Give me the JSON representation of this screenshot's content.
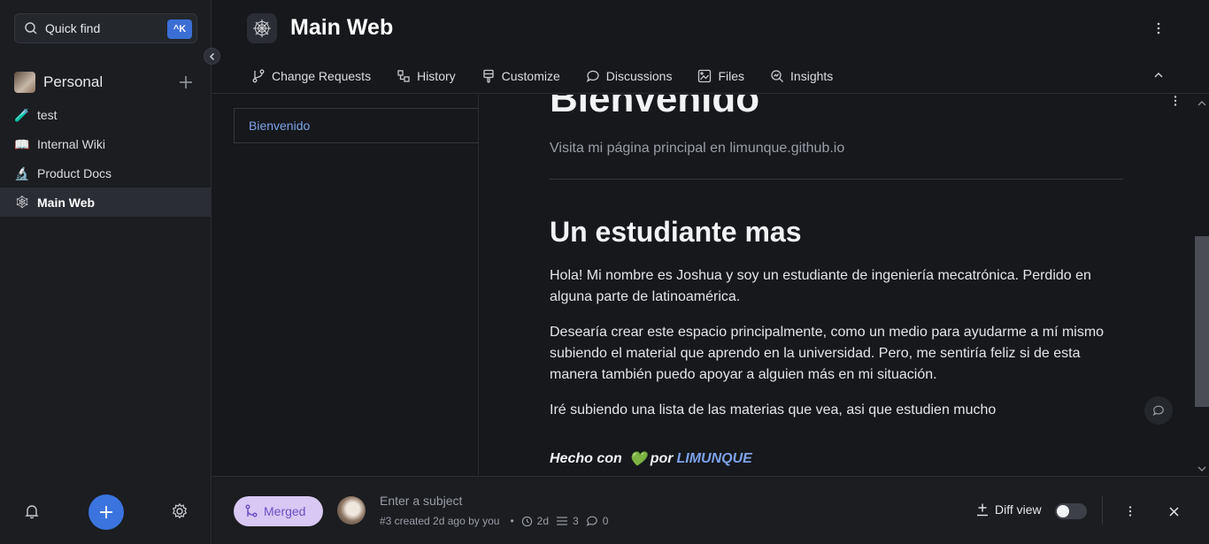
{
  "sidebar": {
    "search": {
      "label": "Quick find",
      "shortcut": "^K"
    },
    "space": {
      "name": "Personal"
    },
    "items": [
      {
        "emoji": "🧪",
        "label": "test"
      },
      {
        "emoji": "📖",
        "label": "Internal Wiki"
      },
      {
        "emoji": "🔬",
        "label": "Product Docs"
      },
      {
        "emoji": "🕸",
        "label": "Main Web"
      }
    ],
    "active_item": "Main Web"
  },
  "header": {
    "title": "Main Web",
    "tabs": [
      {
        "icon": "change-requests-icon",
        "label": "Change Requests"
      },
      {
        "icon": "history-icon",
        "label": "History"
      },
      {
        "icon": "customize-icon",
        "label": "Customize"
      },
      {
        "icon": "discussions-icon",
        "label": "Discussions"
      },
      {
        "icon": "files-icon",
        "label": "Files"
      },
      {
        "icon": "insights-icon",
        "label": "Insights"
      }
    ]
  },
  "toc": {
    "items": [
      {
        "label": "Bienvenido"
      }
    ]
  },
  "document": {
    "title": "Bienvenido",
    "subtitle": "Visita mi página principal en limunque.github.io",
    "heading": "Un estudiante mas",
    "paragraphs": [
      "Hola! Mi nombre es Joshua y soy un estudiante de ingeniería mecatrónica. Perdido en alguna parte de latinoamérica.",
      "Desearía crear este espacio principalmente, como un medio para ayudarme a mí mismo subiendo el material que aprendo en la universidad. Pero, me sentiría feliz si de esta manera también puedo apoyar a alguien más en mi situación.",
      "Iré subiendo una lista de las materias que vea, asi que estudien mucho"
    ],
    "footer_prefix": "Hecho con",
    "footer_heart": "💚",
    "footer_by": "por",
    "footer_link": "LIMUNQUE"
  },
  "change_request": {
    "status": "Merged",
    "subject_placeholder": "Enter a subject",
    "meta_text": "#3 created 2d ago by you",
    "age": "2d",
    "changes_count": "3",
    "comments_count": "0",
    "diff_view_label": "Diff view",
    "diff_view_enabled": false
  },
  "colors": {
    "accent": "#3b74de",
    "merged_bg": "#d8c8f4",
    "merged_text": "#6b4fc2",
    "link": "#7da2e8",
    "heart": "#2e9e4a"
  }
}
